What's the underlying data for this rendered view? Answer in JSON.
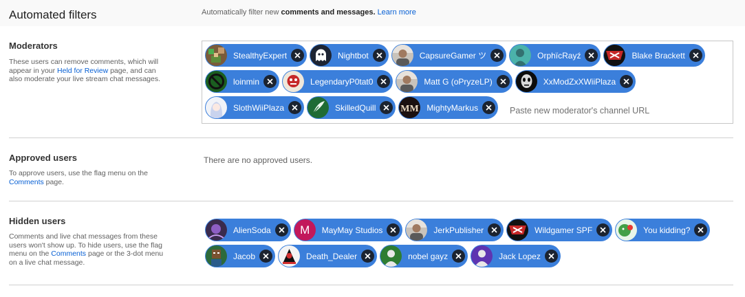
{
  "page": {
    "title": "Automated filters",
    "description_plain": "Automatically filter new ",
    "description_bold": "comments and messages.",
    "learn_more": "Learn more"
  },
  "moderators": {
    "title": "Moderators",
    "desc_1": "These users can remove comments, which will appear in your ",
    "desc_link": "Held for Review",
    "desc_2": " page, and can also moderate your live stream chat messages.",
    "input_placeholder": "Paste new moderator's channel URL",
    "rows": [
      [
        {
          "name": "StealthyExpert",
          "avatar": "pixel-game-avatar"
        },
        {
          "name": "Nightbot",
          "avatar": "ghost-avatar"
        },
        {
          "name": "CapsureGamer ツ",
          "avatar": "photo-avatar"
        },
        {
          "name": "OrphïcRayź",
          "avatar": "teal-portrait-avatar"
        },
        {
          "name": "Blake Brackett",
          "avatar": "red-logo-avatar"
        }
      ],
      [
        {
          "name": "loinmin",
          "avatar": "green-circle-avatar"
        },
        {
          "name": "LegendaryP0tat0",
          "avatar": "cartoon-avatar"
        },
        {
          "name": "Matt G (oPryzeLP)",
          "avatar": "photo-avatar"
        },
        {
          "name": "XxModZxXWiiPlaza",
          "avatar": "mask-avatar"
        }
      ],
      [
        {
          "name": "SlothWiiPlaza",
          "avatar": "anime-avatar"
        },
        {
          "name": "SkilledQuill",
          "avatar": "quill-avatar"
        },
        {
          "name": "MightyMarkus",
          "avatar": "mm-logo-avatar"
        }
      ]
    ]
  },
  "approved": {
    "title": "Approved users",
    "desc_1": "To approve users, use the flag menu on the ",
    "desc_link": "Comments",
    "desc_2": " page.",
    "empty": "There are no approved users."
  },
  "hidden": {
    "title": "Hidden users",
    "desc_1": "Comments and live chat messages from these users won't show up. To hide users, use the flag menu on the ",
    "desc_link": "Comments",
    "desc_2": " page or the 3-dot menu on a live chat message.",
    "rows": [
      [
        {
          "name": "AlienSoda",
          "avatar": "purple-art-avatar"
        },
        {
          "name": "MayMay Studios",
          "avatar": "letter-avatar",
          "letter": "M",
          "color": "#c2185b"
        },
        {
          "name": "JerkPublisher",
          "avatar": "photo-avatar"
        },
        {
          "name": "Wildgamer SPF",
          "avatar": "red-logo-avatar"
        },
        {
          "name": "You kidding?",
          "avatar": "green-cartoon-avatar"
        }
      ],
      [
        {
          "name": "Jacob",
          "avatar": "minecraft-avatar"
        },
        {
          "name": "Death_Dealer",
          "avatar": "red-figure-avatar"
        },
        {
          "name": "nobel gayz",
          "avatar": "default-green-avatar",
          "color": "#2e7d32"
        },
        {
          "name": "Jack Lopez",
          "avatar": "default-purple-avatar",
          "color": "#5e35b1"
        }
      ]
    ]
  },
  "colors": {
    "chip": "#3b7fdb",
    "remove_button": "#1b2330",
    "link": "#065fd4"
  }
}
